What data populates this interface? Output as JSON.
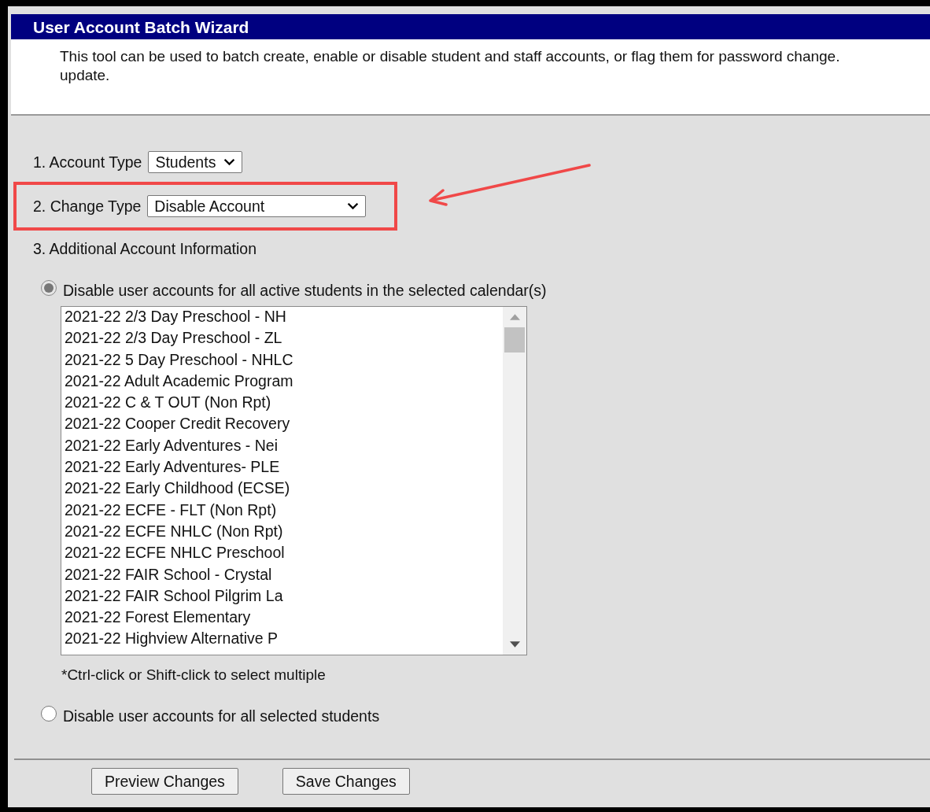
{
  "window": {
    "title": "User Account Batch Wizard"
  },
  "description_lines": [
    "This tool can be used to batch create, enable or disable student and staff accounts, or flag them for password change.",
    "update."
  ],
  "fields": [
    {
      "label": "1. Account Type",
      "value": "Students",
      "highlighted": false
    },
    {
      "label": "2. Change Type",
      "value": "Disable Account",
      "highlighted": true
    }
  ],
  "section_label": "3. Additional Account Information",
  "options": [
    {
      "label": "Disable user accounts for all active students in the selected calendar(s)",
      "selected": true
    },
    {
      "label": "Disable user accounts for all selected students",
      "selected": false
    }
  ],
  "calendars": [
    "2021-22 2/3 Day Preschool - NH",
    "2021-22 2/3 Day Preschool - ZL",
    "2021-22 5 Day Preschool - NHLC",
    "2021-22 Adult Academic Program",
    "2021-22 C & T OUT (Non Rpt)",
    "2021-22 Cooper Credit Recovery",
    "2021-22 Early Adventures - Nei",
    "2021-22 Early Adventures- PLE",
    "2021-22 Early Childhood (ECSE)",
    "2021-22 ECFE - FLT (Non Rpt)",
    "2021-22 ECFE NHLC (Non Rpt)",
    "2021-22 ECFE NHLC Preschool",
    "2021-22 FAIR School - Crystal",
    "2021-22 FAIR School Pilgrim La",
    "2021-22 Forest Elementary",
    "2021-22 Highview Alternative P"
  ],
  "hint": "*Ctrl-click or Shift-click to select multiple",
  "buttons": [
    "Preview Changes",
    "Save Changes"
  ]
}
